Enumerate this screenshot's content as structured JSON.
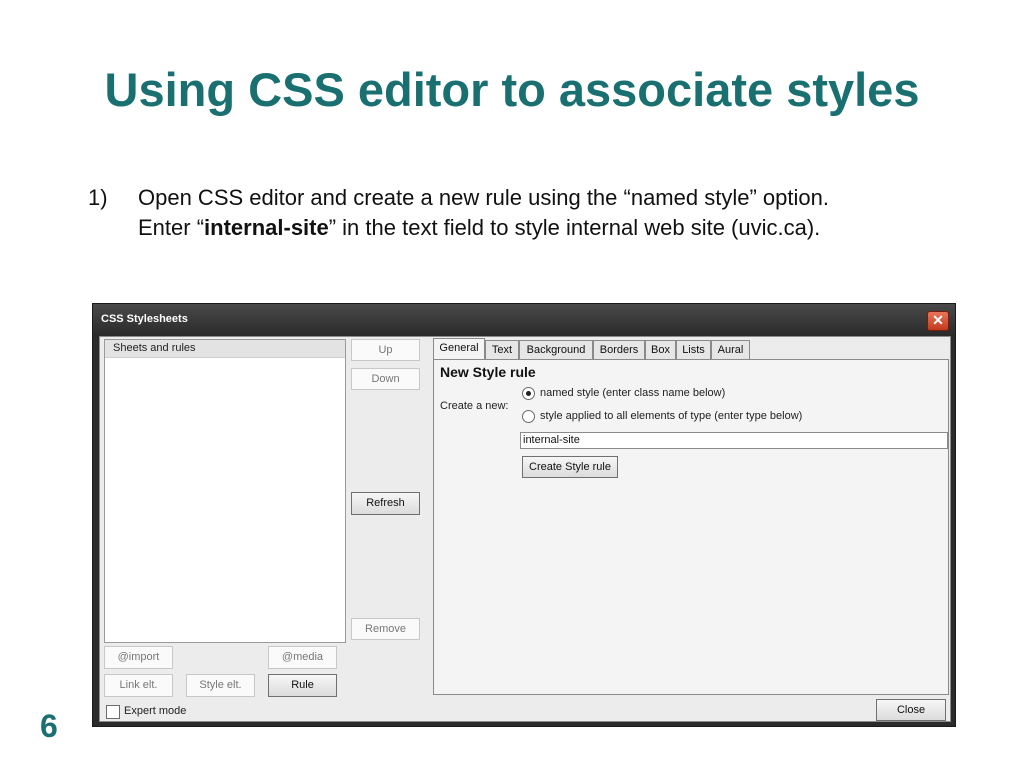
{
  "slide": {
    "title": "Using CSS editor to associate styles",
    "bullet_number": "1)",
    "bullet_line1": "Open CSS editor and create a new rule using the “named style” option.",
    "bullet_line2_pre": "Enter “",
    "bullet_line2_bold": "internal-site",
    "bullet_line2_post": "” in the text field to style internal web site (uvic.ca).",
    "page_number": "6",
    "title_color": "#1a7070"
  },
  "dialog": {
    "title": "CSS Stylesheets",
    "close_icon": "close-icon",
    "tree_header": "Sheets and rules",
    "buttons": {
      "up": "Up",
      "down": "Down",
      "refresh": "Refresh",
      "remove": "Remove",
      "import": "@import",
      "media": "@media",
      "link_elt": "Link elt.",
      "style_elt": "Style elt.",
      "rule": "Rule",
      "close": "Close"
    },
    "tabs": [
      "General",
      "Text",
      "Background",
      "Borders",
      "Box",
      "Lists",
      "Aural"
    ],
    "selected_tab": "General",
    "panel": {
      "title": "New Style rule",
      "create_label": "Create a new:",
      "radio_named": "named style (enter class name below)",
      "radio_type": "style applied to all elements of type (enter type below)",
      "selected_radio": "named",
      "class_name_value": "internal-site",
      "create_button": "Create Style rule"
    },
    "expert_mode_label": "Expert mode",
    "expert_mode_checked": false
  }
}
